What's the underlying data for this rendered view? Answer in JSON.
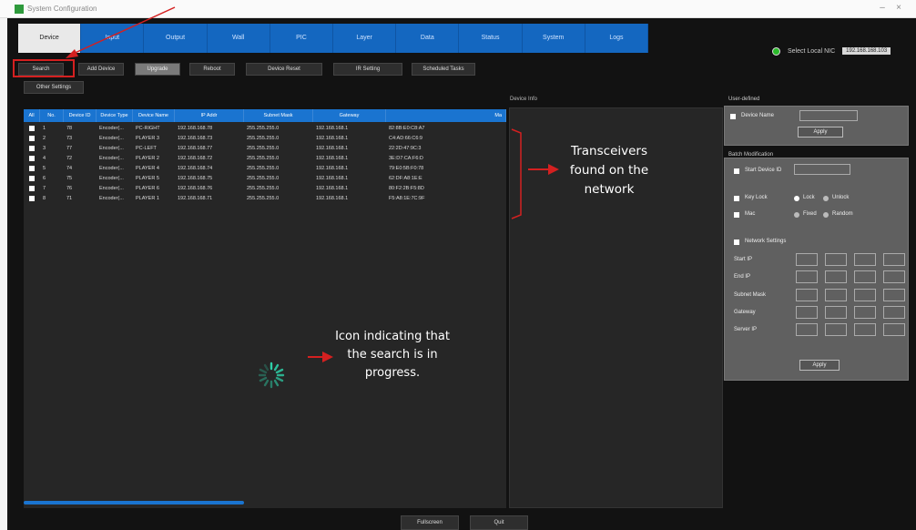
{
  "window": {
    "title": "System Configuration"
  },
  "tabs": [
    "Device",
    "Input",
    "Output",
    "Wall",
    "PIC",
    "Layer",
    "Data",
    "Status",
    "System",
    "Logs"
  ],
  "nic": {
    "label": "Select Local NIC",
    "ip": "192.168.168.103"
  },
  "toolbar": {
    "search": "Search",
    "add_device": "Add Device",
    "upgrade": "Upgrade",
    "reboot": "Reboot",
    "device_reset": "Device Reset",
    "ir_setting": "IR Setting",
    "scheduled_tasks": "Scheduled Tasks",
    "other_settings": "Other Settings"
  },
  "table": {
    "headers": [
      "All",
      "No.",
      "Device ID",
      "Device Type",
      "Device Name",
      "IP Addr",
      "Subnet Mask",
      "Gateway",
      "Ma"
    ],
    "rows": [
      [
        "1",
        "78",
        "Encoder(...",
        "PC-RIGHT",
        "192.168.168.78",
        "255.255.255.0",
        "192.168.168.1",
        "82:8B:E0:C8:A7"
      ],
      [
        "2",
        "73",
        "Encoder(...",
        "PLAYER 3",
        "192.168.168.73",
        "255.255.255.0",
        "192.168.168.1",
        "C4:AD:66:C6:9"
      ],
      [
        "3",
        "77",
        "Encoder(...",
        "PC-LEFT",
        "192.168.168.77",
        "255.255.255.0",
        "192.168.168.1",
        "22:2D:47:9C:3"
      ],
      [
        "4",
        "72",
        "Encoder(...",
        "PLAYER 2",
        "192.168.168.72",
        "255.255.255.0",
        "192.168.168.1",
        "3E:D7:CA:F6:D"
      ],
      [
        "5",
        "74",
        "Encoder(...",
        "PLAYER 4",
        "192.168.168.74",
        "255.255.255.0",
        "192.168.168.1",
        "79:E0:5B:F0:78"
      ],
      [
        "6",
        "75",
        "Encoder(...",
        "PLAYER 5",
        "192.168.168.75",
        "255.255.255.0",
        "192.168.168.1",
        "62:DF:A8:1E:E"
      ],
      [
        "7",
        "76",
        "Encoder(...",
        "PLAYER 6",
        "192.168.168.76",
        "255.255.255.0",
        "192.168.168.1",
        "80:F2:2B:F5:8D"
      ],
      [
        "8",
        "71",
        "Encoder(...",
        "PLAYER 1",
        "192.168.168.71",
        "255.255.255.0",
        "192.168.168.1",
        "F5:A8:1E:7C:9F"
      ]
    ]
  },
  "device_info": {
    "label": "Device Info"
  },
  "user_defined": {
    "label": "User-defined",
    "device_name": "Device Name",
    "apply": "Apply"
  },
  "batch": {
    "label": "Batch Modification",
    "start_id": "Start Device ID",
    "key_lock": "Key Lock",
    "lock": "Lock",
    "unlock": "Unlock",
    "mac": "Mac",
    "fixed": "Fixed",
    "random": "Random",
    "network": "Network Settings",
    "start_ip": "Start IP",
    "end_ip": "End IP",
    "subnet": "Subnet Mask",
    "gateway": "Gateway",
    "server_ip": "Server IP",
    "apply": "Apply"
  },
  "bottom": {
    "fullscreen": "Fullscreen",
    "quit": "Quit"
  },
  "annotations": {
    "transceivers": [
      "Transceivers",
      "found on the",
      "network"
    ],
    "spinner": [
      "Icon indicating that",
      "the search is in",
      "progress."
    ]
  }
}
